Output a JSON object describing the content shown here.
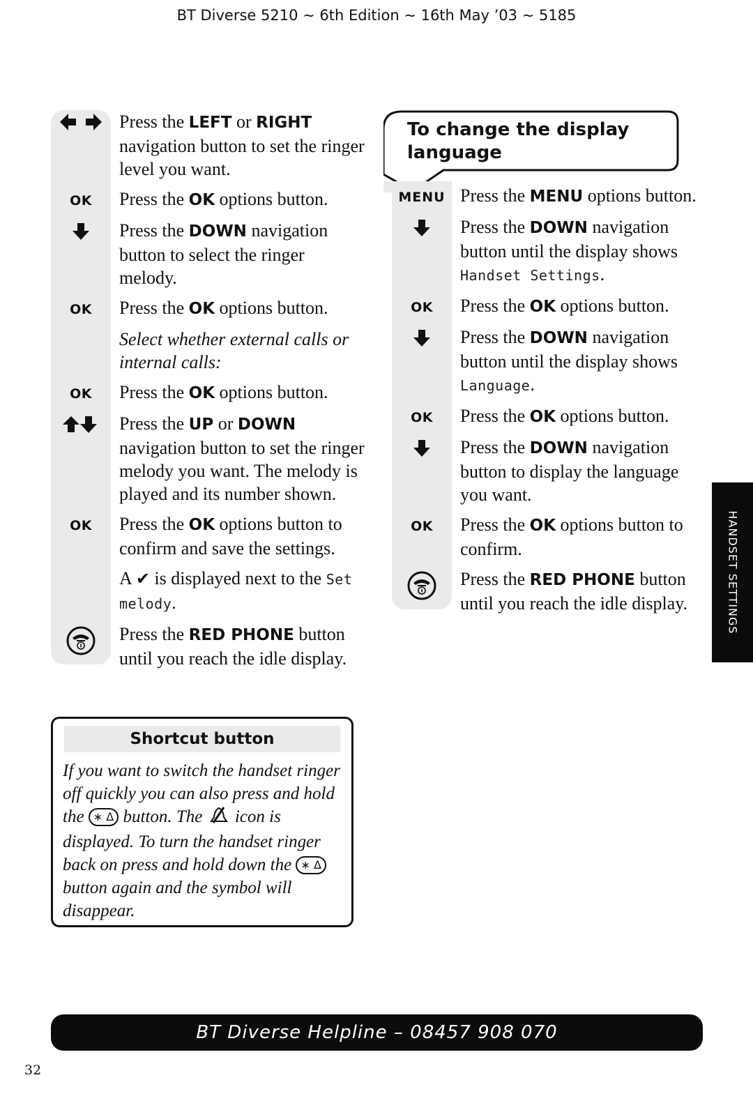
{
  "header": {
    "running_title": "BT Diverse 5210 ~ 6th Edition ~ 16th May ’03 ~ 5185"
  },
  "left_steps": [
    {
      "icon": "left-right-arrows-icon",
      "parts": [
        [
          "t",
          "Press the "
        ],
        [
          "b",
          "LEFT"
        ],
        [
          "t",
          " or "
        ],
        [
          "b",
          "RIGHT"
        ],
        [
          "t",
          " navigation button to set the ringer level you want."
        ]
      ]
    },
    {
      "icon": "ok-label",
      "label": "OK",
      "parts": [
        [
          "t",
          "Press the "
        ],
        [
          "b",
          "OK"
        ],
        [
          "t",
          " options button."
        ]
      ]
    },
    {
      "icon": "down-arrow-icon",
      "parts": [
        [
          "t",
          "Press the "
        ],
        [
          "b",
          "DOWN"
        ],
        [
          "t",
          " navigation button to select the ringer melody."
        ]
      ]
    },
    {
      "icon": "ok-label",
      "label": "OK",
      "parts": [
        [
          "t",
          "Press the "
        ],
        [
          "b",
          "OK"
        ],
        [
          "t",
          " options button."
        ]
      ]
    },
    {
      "icon": "none",
      "parts": [
        [
          "i",
          "Select whether external calls or internal calls:"
        ]
      ]
    },
    {
      "icon": "ok-label",
      "label": "OK",
      "parts": [
        [
          "t",
          "Press the "
        ],
        [
          "b",
          "OK"
        ],
        [
          "t",
          " options button."
        ]
      ]
    },
    {
      "icon": "up-down-arrows-icon",
      "parts": [
        [
          "t",
          "Press the "
        ],
        [
          "b",
          "UP"
        ],
        [
          "t",
          " or "
        ],
        [
          "b",
          "DOWN"
        ],
        [
          "t",
          " navigation button to set the ringer melody you want. The melody is played and its number shown."
        ]
      ]
    },
    {
      "icon": "ok-label",
      "label": "OK",
      "parts": [
        [
          "t",
          "Press the "
        ],
        [
          "b",
          "OK"
        ],
        [
          "t",
          " options button to confirm and save the settings."
        ]
      ]
    },
    {
      "icon": "none",
      "parts": [
        [
          "t",
          "A "
        ],
        [
          "check",
          "✔"
        ],
        [
          "t",
          " is displayed next to the "
        ],
        [
          "lcd",
          "Set melody"
        ],
        [
          "t",
          "."
        ]
      ]
    },
    {
      "icon": "red-phone-icon",
      "parts": [
        [
          "t",
          "Press the "
        ],
        [
          "b",
          "RED PHONE"
        ],
        [
          "t",
          " button until you reach the idle display."
        ]
      ]
    }
  ],
  "shortcut": {
    "title": "Shortcut button",
    "parts": [
      [
        "t",
        "If you want to switch the handset ringer off quickly you can also press and hold the "
      ],
      [
        "key",
        "∗ Δ"
      ],
      [
        "t",
        " button. The "
      ],
      [
        "bell",
        "bell-off-icon"
      ],
      [
        "t",
        " icon is displayed. To turn the handset ringer back on press and hold down the "
      ],
      [
        "key",
        "∗ Δ"
      ],
      [
        "t",
        " button again and the symbol will disappear."
      ]
    ]
  },
  "language_section": {
    "heading": "To change the display language",
    "steps": [
      {
        "icon": "menu-label",
        "label": "MENU",
        "parts": [
          [
            "t",
            "Press the "
          ],
          [
            "b",
            "MENU"
          ],
          [
            "t",
            " options button."
          ]
        ]
      },
      {
        "icon": "down-arrow-icon",
        "parts": [
          [
            "t",
            "Press the "
          ],
          [
            "b",
            "DOWN"
          ],
          [
            "t",
            " navigation button until the display shows "
          ],
          [
            "lcd",
            "Handset Settings"
          ],
          [
            "t",
            "."
          ]
        ]
      },
      {
        "icon": "ok-label",
        "label": "OK",
        "parts": [
          [
            "t",
            "Press the "
          ],
          [
            "b",
            "OK"
          ],
          [
            "t",
            " options button."
          ]
        ]
      },
      {
        "icon": "down-arrow-icon",
        "parts": [
          [
            "t",
            "Press the "
          ],
          [
            "b",
            "DOWN"
          ],
          [
            "t",
            " navigation button until the display shows "
          ],
          [
            "lcd",
            "Language"
          ],
          [
            "t",
            "."
          ]
        ]
      },
      {
        "icon": "ok-label",
        "label": "OK",
        "parts": [
          [
            "t",
            "Press the "
          ],
          [
            "b",
            "OK"
          ],
          [
            "t",
            " options button."
          ]
        ]
      },
      {
        "icon": "down-arrow-icon",
        "parts": [
          [
            "t",
            "Press the "
          ],
          [
            "b",
            "DOWN"
          ],
          [
            "t",
            " navigation button to display the language you want."
          ]
        ]
      },
      {
        "icon": "ok-label",
        "label": "OK",
        "parts": [
          [
            "t",
            "Press the "
          ],
          [
            "b",
            "OK"
          ],
          [
            "t",
            " options button to confirm."
          ]
        ]
      },
      {
        "icon": "red-phone-icon",
        "parts": [
          [
            "t",
            "Press the "
          ],
          [
            "b",
            "RED PHONE"
          ],
          [
            "t",
            " button until you reach the idle display."
          ]
        ]
      }
    ]
  },
  "side_tab": {
    "label": "HANDSET SETTINGS"
  },
  "footer": {
    "helpline": "BT Diverse Helpline – 08457 908 070",
    "page_number": "32"
  },
  "colors": {
    "gutter": "#e8ebea",
    "bar": "#0a0c0b",
    "text": "#111111"
  }
}
